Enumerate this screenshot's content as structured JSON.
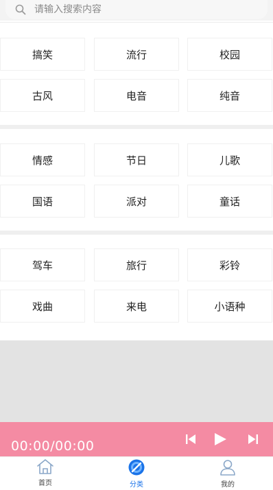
{
  "search": {
    "placeholder": "请输入搜索内容"
  },
  "sections": [
    [
      "搞笑",
      "流行",
      "校园",
      "古风",
      "电音",
      "纯音"
    ],
    [
      "情感",
      "节日",
      "儿歌",
      "国语",
      "派对",
      "童话"
    ],
    [
      "驾车",
      "旅行",
      "彩铃",
      "戏曲",
      "来电",
      "小语种"
    ]
  ],
  "player": {
    "time": "00:00/00:00"
  },
  "tabs": [
    {
      "label": "首页"
    },
    {
      "label": "分类"
    },
    {
      "label": "我的"
    }
  ],
  "colors": {
    "player_bg": "#f48ba3",
    "active_tab": "#1a73e8"
  }
}
